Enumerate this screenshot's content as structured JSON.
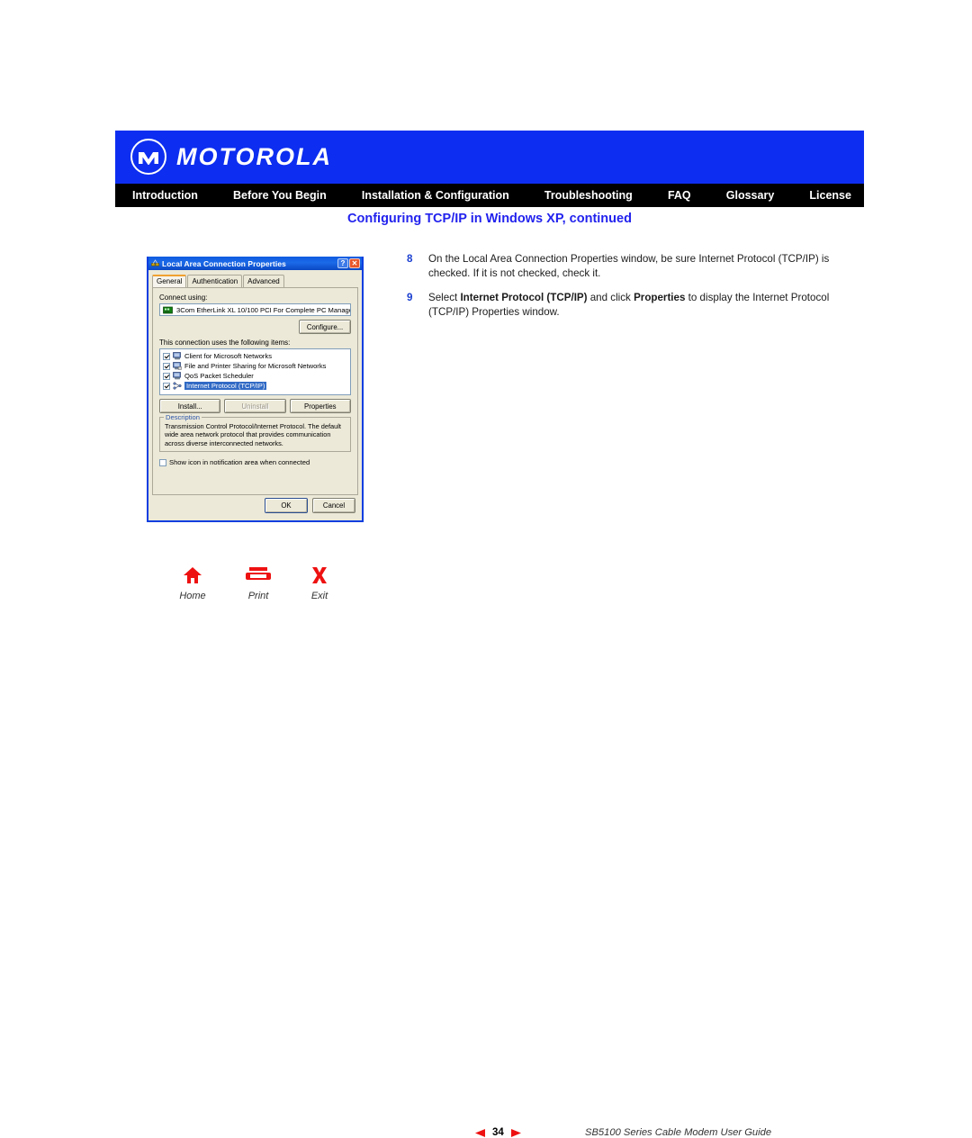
{
  "header": {
    "brand": "MOTOROLA",
    "logo_icon": "motorola-m-logo",
    "bg_color": "#0d2ef0"
  },
  "nav": {
    "bg_color": "#000000",
    "items": [
      {
        "label": "Introduction"
      },
      {
        "label": "Before You Begin"
      },
      {
        "label": "Installation & Configuration"
      },
      {
        "label": "Troubleshooting"
      },
      {
        "label": "FAQ"
      },
      {
        "label": "Glossary"
      },
      {
        "label": "License"
      }
    ]
  },
  "page_title": {
    "text": "Configuring TCP/IP in Windows XP, continued",
    "color": "#2222ee"
  },
  "instructions": [
    {
      "number": "8",
      "parts": [
        {
          "text": "On the Local Area Connection Properties window, be sure Internet Protocol (TCP/IP) is checked. If it is not checked, check it.",
          "bold": false
        }
      ]
    },
    {
      "number": "9",
      "parts": [
        {
          "text": "Select ",
          "bold": false
        },
        {
          "text": "Internet Protocol (TCP/IP)",
          "bold": true
        },
        {
          "text": " and click ",
          "bold": false
        },
        {
          "text": "Properties",
          "bold": true
        },
        {
          "text": " to display the Internet Protocol (TCP/IP) Properties window.",
          "bold": false
        }
      ]
    }
  ],
  "dialog": {
    "title": "Local Area Connection Properties",
    "title_icon": "network-connection-icon",
    "help_button": "?",
    "close_button": "✕",
    "tabs": [
      {
        "label": "General",
        "active": true
      },
      {
        "label": "Authentication",
        "active": false
      },
      {
        "label": "Advanced",
        "active": false
      }
    ],
    "connect_using_label": "Connect using:",
    "adapter": {
      "icon": "network-adapter-icon",
      "name": "3Com EtherLink XL 10/100 PCI For Complete PC Manage"
    },
    "configure_button": "Configure...",
    "items_label": "This connection uses the following items:",
    "items": [
      {
        "label": "Client for Microsoft Networks",
        "checked": true,
        "selected": false,
        "icon": "client-network-icon"
      },
      {
        "label": "File and Printer Sharing for Microsoft Networks",
        "checked": true,
        "selected": false,
        "icon": "file-printer-sharing-icon"
      },
      {
        "label": "QoS Packet Scheduler",
        "checked": true,
        "selected": false,
        "icon": "qos-scheduler-icon"
      },
      {
        "label": "Internet Protocol (TCP/IP)",
        "checked": true,
        "selected": true,
        "icon": "protocol-icon"
      }
    ],
    "buttons": {
      "install": "Install...",
      "uninstall": "Uninstall",
      "properties": "Properties"
    },
    "description_legend": "Description",
    "description_text": "Transmission Control Protocol/Internet Protocol. The default wide area network protocol that provides communication across diverse interconnected networks.",
    "notify_checkbox": {
      "label": "Show icon in notification area when connected",
      "checked": false
    },
    "ok_button": "OK",
    "cancel_button": "Cancel",
    "selection_color": "#316ac5",
    "titlebar_color": "#0f5ce0"
  },
  "footer": {
    "buttons": [
      {
        "label": "Home",
        "icon": "home-icon"
      },
      {
        "label": "Print",
        "icon": "printer-icon"
      },
      {
        "label": "Exit",
        "icon": "exit-x-icon"
      }
    ],
    "pager": {
      "prev_icon": "left-triangle-icon",
      "next_icon": "right-triangle-icon",
      "page": "34"
    },
    "guide_title": "SB5100 Series Cable Modem User Guide",
    "accent_color": "#ee1111"
  }
}
